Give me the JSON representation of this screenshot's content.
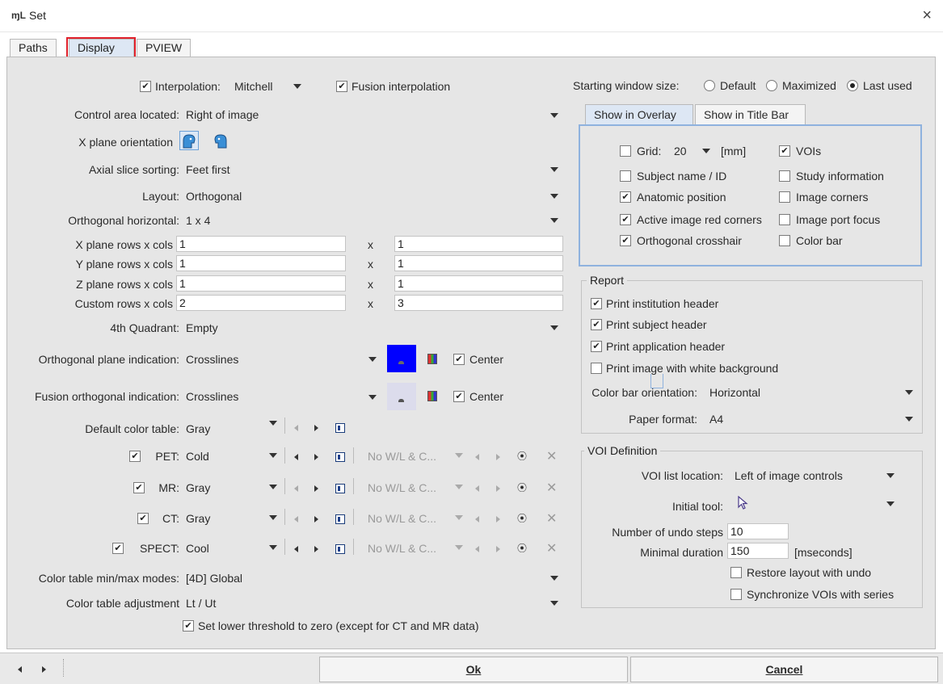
{
  "window": {
    "title": "Set",
    "close": "×",
    "app_icon_text": "ɱL"
  },
  "tabs": [
    {
      "label": "Paths"
    },
    {
      "label": "Display"
    },
    {
      "label": "PVIEW"
    }
  ],
  "left": {
    "interpolation": {
      "checked": "✔",
      "label": "Interpolation:",
      "value": "Mitchell"
    },
    "fusion_interpolation": {
      "checked": "✔",
      "label": "Fusion interpolation"
    },
    "control_area": {
      "label": "Control area located:",
      "value": "Right of image"
    },
    "x_plane_orientation": {
      "label": "X plane orientation"
    },
    "axial_slice_sorting": {
      "label": "Axial slice sorting:",
      "value": "Feet first"
    },
    "layout": {
      "label": "Layout:",
      "value": "Orthogonal"
    },
    "orthogonal_horizontal": {
      "label": "Orthogonal horizontal:",
      "value": "1 x 4"
    },
    "rows_cols": [
      {
        "label": "X plane rows x cols",
        "rows": "1",
        "x": "x",
        "cols": "1"
      },
      {
        "label": "Y plane rows x cols",
        "rows": "1",
        "x": "x",
        "cols": "1"
      },
      {
        "label": "Z plane rows x cols",
        "rows": "1",
        "x": "x",
        "cols": "1"
      },
      {
        "label": "Custom rows x cols",
        "rows": "2",
        "x": "x",
        "cols": "3"
      }
    ],
    "fourth_quadrant": {
      "label": "4th Quadrant:",
      "value": "Empty"
    },
    "orthogonal_plane_indication": {
      "label": "Orthogonal plane indication:",
      "value": "Crosslines",
      "center_checked": "✔",
      "center_label": "Center"
    },
    "fusion_orthogonal_indication": {
      "label": "Fusion orthogonal indication:",
      "value": "Crosslines",
      "center_checked": "✔",
      "center_label": "Center"
    },
    "default_color_table": {
      "label": "Default color table:",
      "value": "Gray"
    },
    "modalities": [
      {
        "checked": "✔",
        "label": "PET:",
        "value": "Cold",
        "wl": "No W/L & C..."
      },
      {
        "checked": "✔",
        "label": "MR:",
        "value": "Gray",
        "wl": "No W/L & C..."
      },
      {
        "checked": "✔",
        "label": "CT:",
        "value": "Gray",
        "wl": "No W/L & C..."
      },
      {
        "checked": "✔",
        "label": "SPECT:",
        "value": "Cool",
        "wl": "No W/L & C..."
      }
    ],
    "color_table_minmax": {
      "label": "Color table min/max modes:",
      "value": "[4D] Global"
    },
    "color_table_adjustment": {
      "label": "Color table adjustment",
      "value": "Lt / Ut"
    },
    "lower_threshold": {
      "checked": "✔",
      "label": "Set lower threshold to zero (except for CT and MR data)"
    }
  },
  "right": {
    "starting_window_size": {
      "label": "Starting window size:",
      "options": [
        "Default",
        "Maximized",
        "Last used"
      ],
      "selected": "Last used"
    },
    "overlay_tabs": [
      {
        "label": "Show in Overlay"
      },
      {
        "label": "Show in Title Bar"
      }
    ],
    "overlay": {
      "grid": {
        "checked": "",
        "label": "Grid:",
        "value": "20",
        "unit": "[mm]"
      },
      "left_items": [
        {
          "checked": "",
          "label": "Subject name / ID"
        },
        {
          "checked": "✔",
          "label": "Anatomic position"
        },
        {
          "checked": "✔",
          "label": "Active image red corners"
        },
        {
          "checked": "✔",
          "label": "Orthogonal crosshair"
        }
      ],
      "right_items": [
        {
          "checked": "✔",
          "label": "VOIs"
        },
        {
          "checked": "",
          "label": "Study information"
        },
        {
          "checked": "",
          "label": "Image corners"
        },
        {
          "checked": "",
          "label": "Image port focus"
        },
        {
          "checked": "",
          "label": "Color bar"
        }
      ]
    },
    "report": {
      "title": "Report",
      "items": [
        {
          "checked": "✔",
          "label": "Print institution header"
        },
        {
          "checked": "✔",
          "label": "Print subject header"
        },
        {
          "checked": "✔",
          "label": "Print application header"
        },
        {
          "checked": "",
          "label": "Print image with white background"
        }
      ],
      "color_bar_orientation": {
        "label": "Color bar orientation:",
        "value": "Horizontal"
      },
      "paper_format": {
        "label": "Paper format:",
        "value": "A4"
      }
    },
    "voi": {
      "title": "VOI Definition",
      "list_location": {
        "label": "VOI list location:",
        "value": "Left of image controls"
      },
      "initial_tool": {
        "label": "Initial tool:"
      },
      "undo_steps": {
        "label": "Number of undo steps",
        "value": "10"
      },
      "minimal_duration": {
        "label": "Minimal duration",
        "value": "150",
        "unit": "[mseconds]"
      },
      "restore_layout": {
        "checked": "",
        "label": "Restore layout with undo"
      },
      "sync_vois": {
        "checked": "",
        "label": "Synchronize VOIs with series"
      }
    }
  },
  "buttons": {
    "ok": "Ok",
    "cancel": "Cancel"
  },
  "colors": {
    "panel": "#e6e6e6",
    "tab_active": "#dde7f4",
    "highlight": "#e0202a",
    "overlay_border": "#8fb2de",
    "indicator_blue": "#0000ff"
  }
}
